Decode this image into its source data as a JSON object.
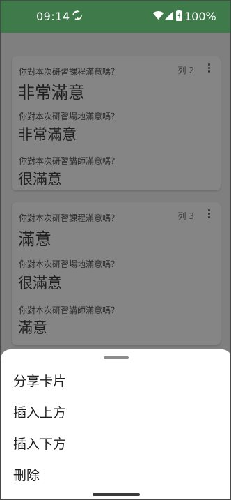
{
  "status_bar": {
    "time": "09:14",
    "battery": "100%",
    "color": "#3f7a4a"
  },
  "cards": [
    {
      "row_label": "列 2",
      "items": [
        {
          "question": "你對本次研習課程滿意嗎？",
          "answer": "非常滿意"
        },
        {
          "question": "你對本次研習場地滿意嗎？",
          "answer": "非常滿意"
        },
        {
          "question": "你對本次研習講師滿意嗎？",
          "answer": "很滿意"
        }
      ]
    },
    {
      "row_label": "列 3",
      "items": [
        {
          "question": "你對本次研習課程滿意嗎？",
          "answer": "滿意"
        },
        {
          "question": "你對本次研習場地滿意嗎？",
          "answer": "很滿意"
        },
        {
          "question": "你對本次研習講師滿意嗎？",
          "answer": "滿意"
        }
      ]
    }
  ],
  "bottom_sheet": {
    "items": [
      "分享卡片",
      "插入上方",
      "插入下方",
      "刪除"
    ]
  }
}
